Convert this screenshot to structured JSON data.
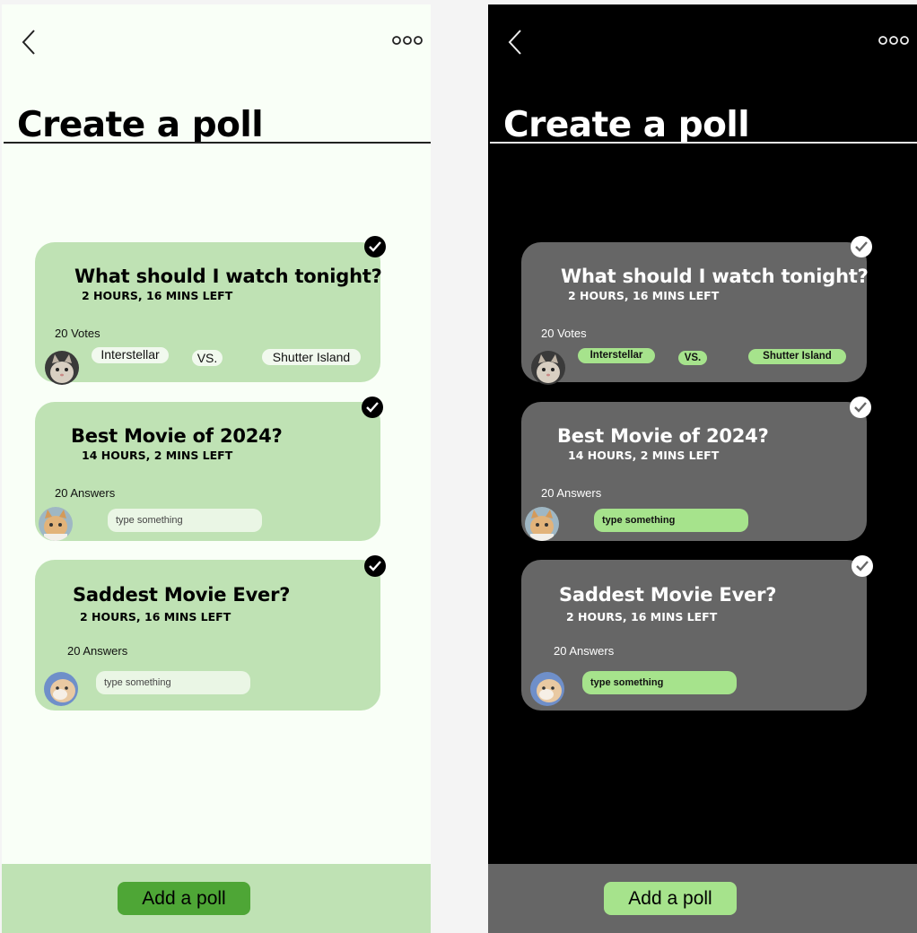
{
  "colors": {
    "light_bg": "#f9fff7",
    "light_card": "#bfe2b4",
    "light_button": "#4ea636",
    "dark_bg": "#000000",
    "dark_card": "#666666",
    "dark_accent": "#a6e38c"
  },
  "icons": {
    "back": "chevron-left-icon",
    "more": "more-horizontal-icon",
    "check": "check-circle-icon"
  },
  "page": {
    "title": "Create a poll",
    "add_button": "Add a poll"
  },
  "polls": [
    {
      "question": "What should I watch tonight?",
      "time_left": "2 HOURS, 16 MINS LEFT",
      "count": "20 Votes",
      "option_a": "Interstellar",
      "vs": "VS.",
      "option_b": "Shutter Island"
    },
    {
      "question": "Best Movie of 2024?",
      "time_left": "14 HOURS, 2 MINS LEFT",
      "count": "20 Answers",
      "input_placeholder": "type something"
    },
    {
      "question": "Saddest Movie Ever?",
      "time_left": "2 HOURS, 16 MINS LEFT",
      "count": "20 Answers",
      "input_placeholder": "type something"
    }
  ]
}
